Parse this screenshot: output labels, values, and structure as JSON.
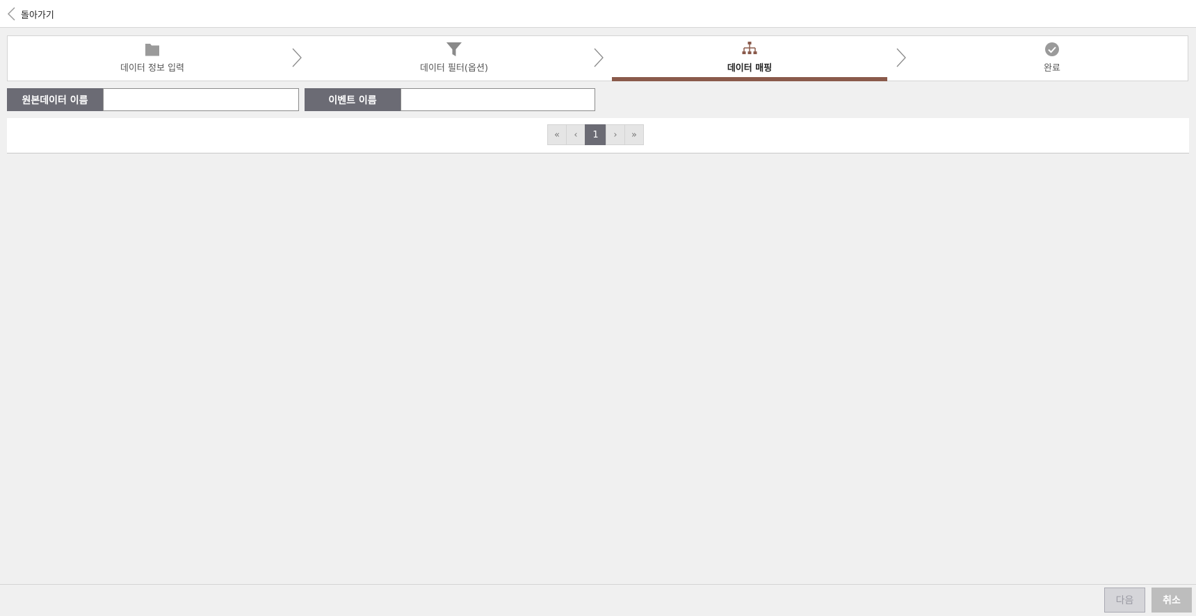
{
  "header": {
    "back_label": "돌아가기"
  },
  "wizard": {
    "active_step": 2,
    "accent_color": "#8a5a4b",
    "steps": [
      {
        "label": "데이터 정보 입력",
        "icon": "folder-icon"
      },
      {
        "label": "데이터 필터(옵션)",
        "icon": "filter-icon"
      },
      {
        "label": "데이터 매핑",
        "icon": "hierarchy-icon"
      },
      {
        "label": "완료",
        "icon": "check-circle-icon"
      }
    ]
  },
  "search": {
    "source_name": {
      "label": "원본데이터 이름",
      "value": ""
    },
    "event_name": {
      "label": "이벤트 이름",
      "value": ""
    }
  },
  "pagination": {
    "first": "«",
    "prev": "‹",
    "current": "1",
    "next": "›",
    "last": "»"
  },
  "footer": {
    "next_label": "다음",
    "cancel_label": "취소"
  }
}
